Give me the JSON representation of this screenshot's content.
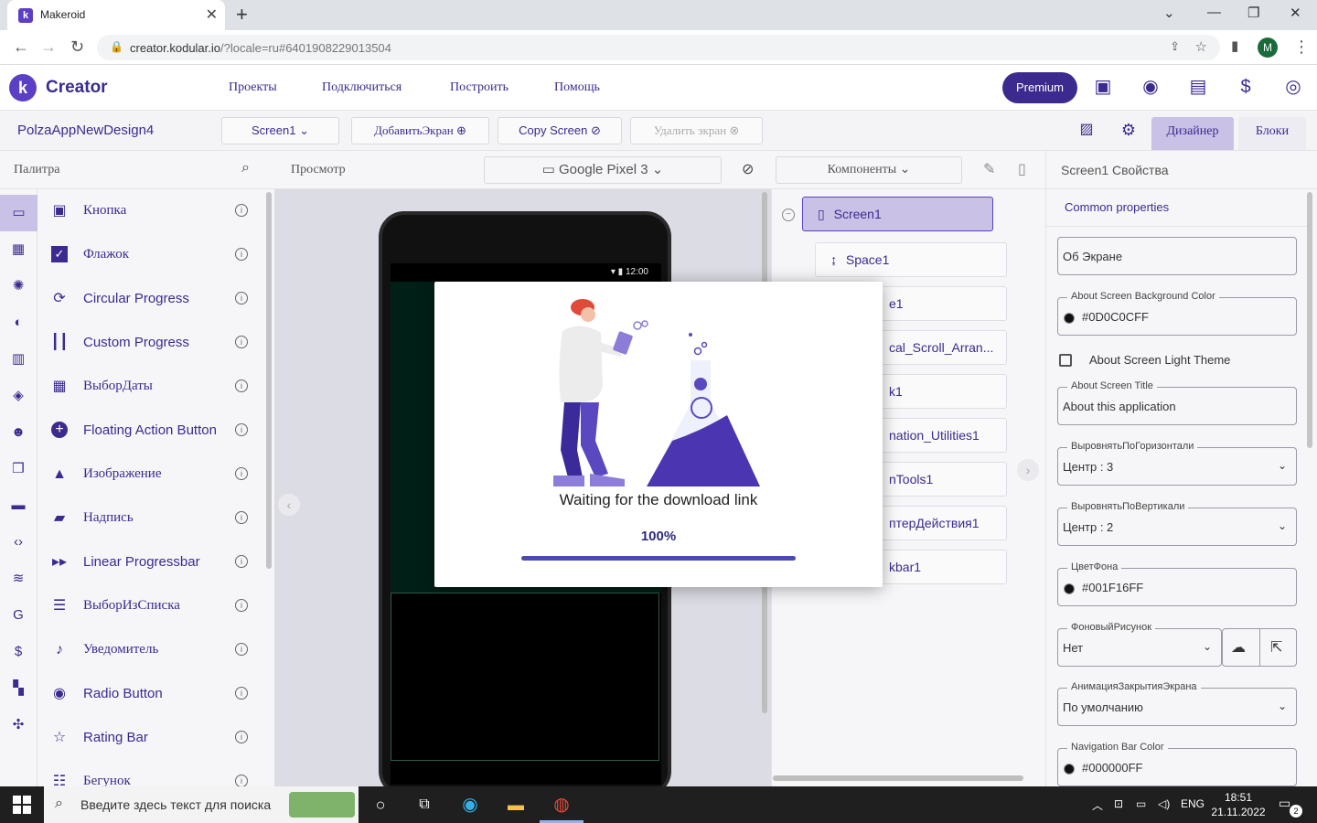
{
  "browser": {
    "tab_title": "Makeroid",
    "url_host": "creator.kodular.io",
    "url_rest": "/?locale=ru#6401908229013504",
    "avatar_letter": "M"
  },
  "header": {
    "logo_letter": "k",
    "brand": "Creator",
    "menu": [
      "Проекты",
      "Подключиться",
      "Построить",
      "Помощь"
    ],
    "premium_label": "Premium"
  },
  "toolbar": {
    "project_name": "PolzaAppNewDesign4",
    "screen_select": "Screen1",
    "add_screen": "ДобавитьЭкран",
    "copy_screen": "Copy Screen",
    "delete_screen": "Удалить экран",
    "designer": "Дизайнер",
    "blocks": "Блоки"
  },
  "palette": {
    "title": "Палитра",
    "items": [
      {
        "name": "Кнопка",
        "icon": "square"
      },
      {
        "name": "Флажок",
        "icon": "check"
      },
      {
        "name": "Circular Progress",
        "icon": "refresh"
      },
      {
        "name": "Custom Progress",
        "icon": "bars"
      },
      {
        "name": "ВыборДаты",
        "icon": "calendar"
      },
      {
        "name": "Floating Action Button",
        "icon": "plus"
      },
      {
        "name": "Изображение",
        "icon": "image"
      },
      {
        "name": "Надпись",
        "icon": "label"
      },
      {
        "name": "Linear Progressbar",
        "icon": "forward"
      },
      {
        "name": "ВыборИзСписка",
        "icon": "list"
      },
      {
        "name": "Уведомитель",
        "icon": "bell"
      },
      {
        "name": "Radio Button",
        "icon": "radio"
      },
      {
        "name": "Rating Bar",
        "icon": "star"
      },
      {
        "name": "Бегунок",
        "icon": "sliders"
      }
    ]
  },
  "viewer": {
    "title": "Просмотр",
    "device": "Google Pixel 3",
    "phone_time": "12:00"
  },
  "components": {
    "title": "Компоненты",
    "items": [
      "Screen1",
      "Space1",
      "e1",
      "cal_Scroll_Arran...",
      "k1",
      "nation_Utilities1",
      "nTools1",
      "птерДействия1",
      "kbar1"
    ]
  },
  "properties": {
    "title": "Screen1 Свойства",
    "common": "Common properties",
    "about_screen": "Об Экране",
    "bg_color_label": "About Screen Background Color",
    "bg_color_value": "#0D0C0CFF",
    "light_theme_label": "About Screen Light Theme",
    "title_label": "About Screen Title",
    "title_value": "About this application",
    "halign_label": "ВыровнятьПоГоризонтали",
    "halign_value": "Центр : 3",
    "valign_label": "ВыровнятьПоВертикали",
    "valign_value": "Центр : 2",
    "bgcolor_label": "ЦветФона",
    "bgcolor_value": "#001F16FF",
    "bgimage_label": "ФоновыйРисунок",
    "bgimage_value": "Нет",
    "close_anim_label": "АнимацияЗакрытияЭкрана",
    "close_anim_value": "По умолчанию",
    "navbar_color_label": "Navigation Bar Color",
    "navbar_color_value": "#000000FF"
  },
  "modal": {
    "message": "Waiting for the download link",
    "percent_text": "100%",
    "progress": 1.0
  },
  "taskbar": {
    "search_placeholder": "Введите здесь текст для поиска",
    "lang": "ENG",
    "time": "18:51",
    "date": "21.11.2022",
    "notif_count": "2"
  },
  "colors": {
    "brand": "#3c2a8f",
    "accent": "#5c3fc4",
    "selected": "#c9c1e6"
  }
}
